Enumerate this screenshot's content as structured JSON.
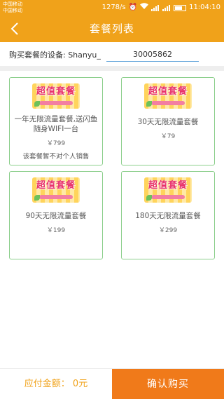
{
  "status_bar": {
    "carrier_1": "中国移动",
    "carrier_2": "中国移动",
    "speed": "1278/s",
    "time": "11:04:10"
  },
  "header": {
    "title": "套餐列表"
  },
  "device": {
    "label": "购买套餐的设备: Shanyu_",
    "value": "30005862"
  },
  "packages": [
    {
      "name": "一年无限流量套餐,送闪鱼随身WIFI一台",
      "price": "￥799",
      "note": "该套餐暂不对个人销售",
      "banner": "超值套餐"
    },
    {
      "name": "30天无限流量套餐",
      "price": "￥79",
      "banner": "超值套餐"
    },
    {
      "name": "90天无限流量套餐",
      "price": "￥199",
      "banner": "超值套餐"
    },
    {
      "name": "180天无限流量套餐",
      "price": "￥299",
      "banner": "超值套餐"
    }
  ],
  "footer": {
    "amount_label": "应付金额： 0元",
    "confirm_label": "确认购买"
  },
  "colors": {
    "brand": "#f0a21a",
    "confirm": "#f07a1a",
    "card_border": "#8ccf8c"
  }
}
